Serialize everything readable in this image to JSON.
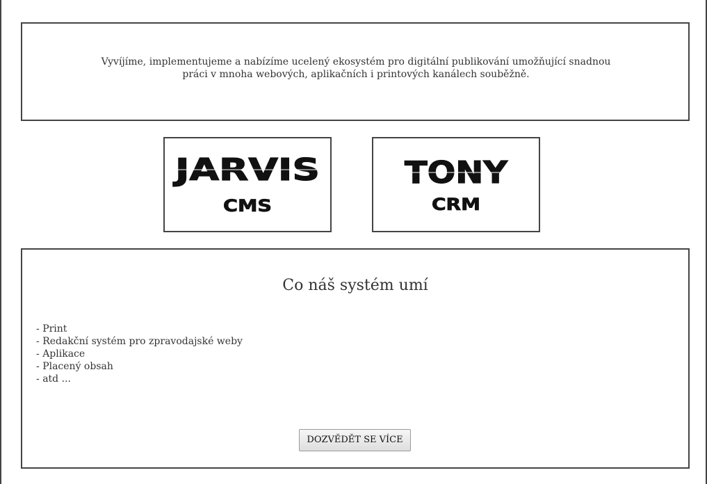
{
  "intro": {
    "text": "Vyvíjíme, implementujeme a nabízíme ucelený ekosystém pro digitální publikování umožňující snadnou práci v mnoha webových, aplikačních i printových kanálech souběžně."
  },
  "products": [
    {
      "name": "JARVIS",
      "subtitle": "CMS"
    },
    {
      "name": "TONY",
      "subtitle": "CRM"
    }
  ],
  "features": {
    "title": "Co náš systém umí",
    "items": [
      "Print",
      "Redakční systém pro zpravodajské weby",
      "Aplikace",
      "Placený obsah",
      "atd ..."
    ],
    "button_label": "DOZVĚDĚT SE VÍCE"
  },
  "colors": {
    "border": "#444444",
    "text": "#333333",
    "logo": "#111111",
    "background": "#ffffff"
  }
}
